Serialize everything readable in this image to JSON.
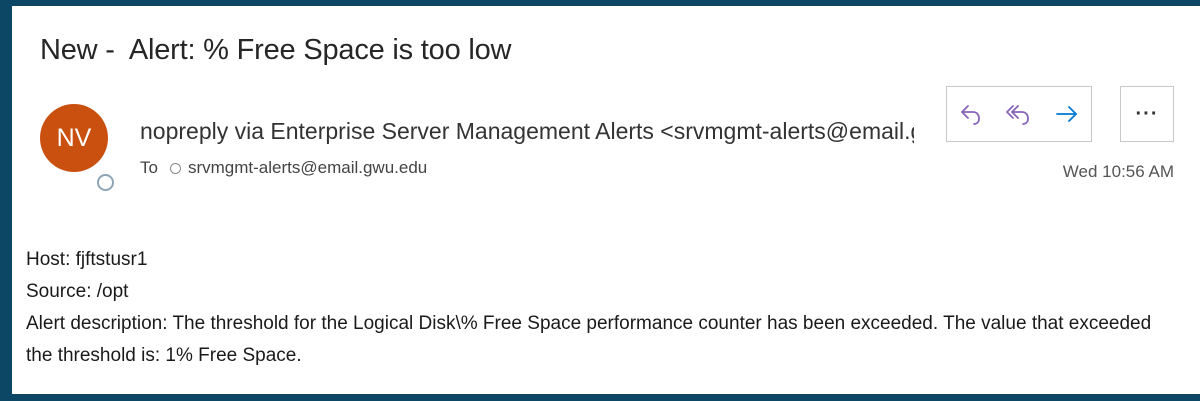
{
  "message": {
    "subject": "New -  Alert: % Free Space is too low",
    "avatar_initials": "NV",
    "sender": "nopreply via Enterprise Server Management Alerts <srvmgmt-alerts@email.gwu.edu>",
    "to_label": "To",
    "recipient": "srvmgmt-alerts@email.gwu.edu",
    "timestamp": "Wed 10:56 AM",
    "body": {
      "host": "Host: fjftstusr1",
      "source": "Source: /opt",
      "description": "Alert description: The threshold for the Logical Disk\\% Free Space performance counter has been exceeded. The value that exceeded the threshold is: 1% Free Space."
    }
  },
  "actions": {
    "reply_icon": "reply-icon",
    "reply_all_icon": "reply-all-icon",
    "forward_icon": "forward-icon",
    "more_label": "···"
  },
  "colors": {
    "avatar": "#ca5010",
    "frame": "#0d4766",
    "reply_accent": "#8764b8",
    "forward_accent": "#0078d4"
  }
}
